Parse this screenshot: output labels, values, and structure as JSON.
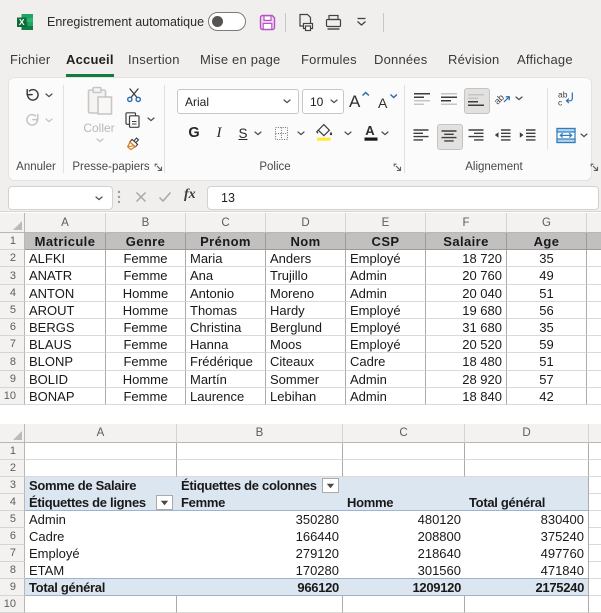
{
  "titlebar": {
    "autosave_label": "Enregistrement automatique",
    "autosave_state": "off",
    "icons": [
      "excel-logo",
      "autosave-toggle",
      "save-icon",
      "print-preview-icon",
      "quick-print-icon",
      "customize-qat-icon"
    ]
  },
  "tabs": {
    "items": [
      {
        "label": "Fichier",
        "active": false
      },
      {
        "label": "Accueil",
        "active": true
      },
      {
        "label": "Insertion",
        "active": false
      },
      {
        "label": "Mise en page",
        "active": false
      },
      {
        "label": "Formules",
        "active": false
      },
      {
        "label": "Données",
        "active": false
      },
      {
        "label": "Révision",
        "active": false
      },
      {
        "label": "Affichage",
        "active": false
      }
    ]
  },
  "ribbon": {
    "undo_group": {
      "label": "Annuler"
    },
    "clipboard_group": {
      "label": "Presse-papiers",
      "paste_label": "Coller"
    },
    "font_group": {
      "label": "Police",
      "font_name": "Arial",
      "font_size": "10",
      "bold_label": "G",
      "italic_label": "I",
      "underline_label": "S"
    },
    "alignment_group": {
      "label": "Alignement"
    }
  },
  "formula_bar": {
    "name_box_value": "",
    "fx_label": "fx",
    "formula_value": "13"
  },
  "sheet1": {
    "col_letters": [
      "A",
      "B",
      "C",
      "D",
      "E",
      "F",
      "G"
    ],
    "row_numbers": [
      "1",
      "2",
      "3",
      "4",
      "5",
      "6",
      "7",
      "8",
      "9",
      "10"
    ],
    "header_row": [
      "Matricule",
      "Genre",
      "Prénom",
      "Nom",
      "CSP",
      "Salaire",
      "Age"
    ],
    "col_align": [
      "left",
      "center",
      "left",
      "left",
      "left",
      "right",
      "center"
    ],
    "data_rows": [
      [
        "ALFKI",
        "Femme",
        "Maria",
        "Anders",
        "Employé",
        "18 720",
        "35"
      ],
      [
        "ANATR",
        "Femme",
        "Ana",
        "Trujillo",
        "Admin",
        "20 760",
        "49"
      ],
      [
        "ANTON",
        "Homme",
        "Antonio",
        "Moreno",
        "Admin",
        "20 040",
        "51"
      ],
      [
        "AROUT",
        "Homme",
        "Thomas",
        "Hardy",
        "Employé",
        "19 680",
        "56"
      ],
      [
        "BERGS",
        "Femme",
        "Christina",
        "Berglund",
        "Employé",
        "31 680",
        "35"
      ],
      [
        "BLAUS",
        "Femme",
        "Hanna",
        "Moos",
        "Employé",
        "20 520",
        "59"
      ],
      [
        "BLONP",
        "Femme",
        "Frédérique",
        "Citeaux",
        "Cadre",
        "18 480",
        "51"
      ],
      [
        "BOLID",
        "Homme",
        "Martín",
        "Sommer",
        "Admin",
        "28 920",
        "57"
      ],
      [
        "BONAP",
        "Femme",
        "Laurence",
        "Lebihan",
        "Admin",
        "18 840",
        "42"
      ]
    ]
  },
  "sheet2": {
    "col_letters": [
      "A",
      "B",
      "C",
      "D"
    ],
    "row_numbers": [
      "1",
      "2",
      "3",
      "4",
      "5",
      "6",
      "7",
      "8",
      "9",
      "10"
    ],
    "pivot": {
      "summary_label": "Somme de Salaire",
      "col_fields_label": "Étiquettes de colonnes",
      "row_fields_label": "Étiquettes de lignes",
      "col_headers": [
        "Femme",
        "Homme",
        "Total général"
      ],
      "data_rows": [
        [
          "Admin",
          "350280",
          "480120",
          "830400"
        ],
        [
          "Cadre",
          "166440",
          "208800",
          "375240"
        ],
        [
          "Employé",
          "279120",
          "218640",
          "497760"
        ],
        [
          "ETAM",
          "170280",
          "301560",
          "471840"
        ]
      ],
      "total_row": [
        "Total général",
        "966120",
        "1209120",
        "2175240"
      ]
    }
  },
  "chart_data": {
    "type": "table",
    "title": "Somme de Salaire",
    "categories": [
      "Admin",
      "Cadre",
      "Employé",
      "ETAM"
    ],
    "series": [
      {
        "name": "Femme",
        "values": [
          350280,
          166440,
          279120,
          170280
        ],
        "total": 966120
      },
      {
        "name": "Homme",
        "values": [
          480120,
          208800,
          218640,
          301560
        ],
        "total": 1209120
      },
      {
        "name": "Total général",
        "values": [
          830400,
          375240,
          497760,
          471840
        ],
        "total": 2175240
      }
    ]
  },
  "colors": {
    "excel_green": "#107c41",
    "chrome_bg": "#f1efee",
    "header_row_fill": "#c1c0bf",
    "pivot_fill": "#dce6f1",
    "pivot_border": "#9db3cf",
    "save_icon_purple": "#b453c4",
    "accent_blue_icons": "#2b6cb0",
    "brush_orange": "#d9822b"
  }
}
